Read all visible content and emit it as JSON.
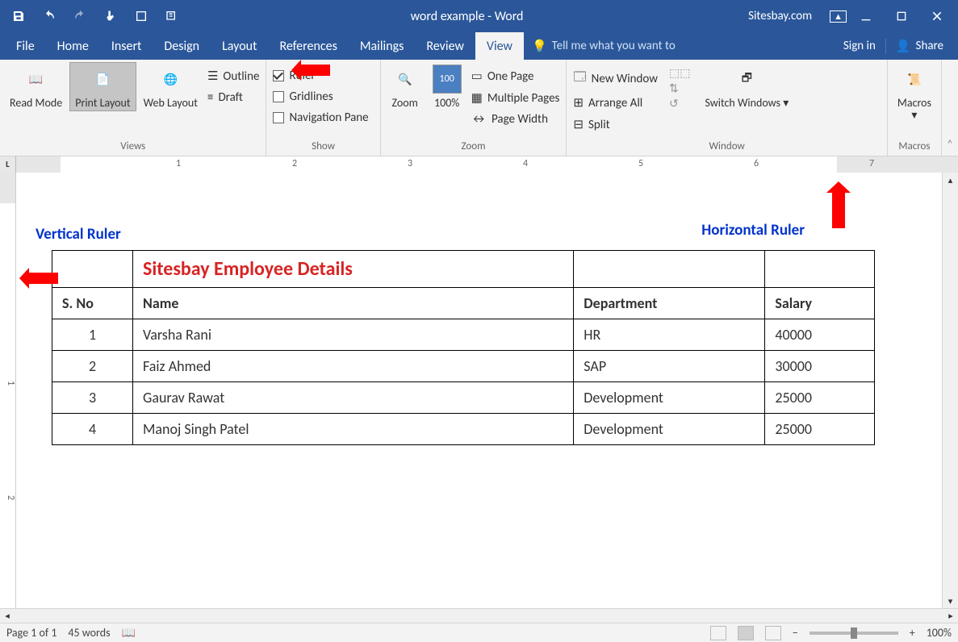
{
  "titlebar": {
    "title": "word example - Word",
    "site": "Sitesbay.com"
  },
  "tabs": {
    "file": "File",
    "home": "Home",
    "insert": "Insert",
    "design": "Design",
    "layout": "Layout",
    "references": "References",
    "mailings": "Mailings",
    "review": "Review",
    "view": "View",
    "tell": "Tell me what you want to",
    "signin": "Sign in",
    "share": "Share"
  },
  "ribbon": {
    "views": {
      "read": "Read Mode",
      "print": "Print Layout",
      "web": "Web Layout",
      "label": "Views"
    },
    "show": {
      "ruler": "Ruler",
      "gridlines": "Gridlines",
      "navpane": "Navigation Pane",
      "outline": "Outline",
      "draft": "Draft",
      "label": "Show"
    },
    "zoom": {
      "zoom": "Zoom",
      "hundred": "100%",
      "onepage": "One Page",
      "multi": "Multiple Pages",
      "width": "Page Width",
      "label": "Zoom"
    },
    "window": {
      "newwin": "New Window",
      "arrange": "Arrange All",
      "split": "Split",
      "switch": "Switch Windows",
      "label": "Window"
    },
    "macros": {
      "macros": "Macros",
      "label": "Macros"
    }
  },
  "annotations": {
    "vruler": "Vertical Ruler",
    "hruler": "Horizontal Ruler"
  },
  "table": {
    "title": "Sitesbay Employee Details",
    "headers": {
      "sno": "S. No",
      "name": "Name",
      "dept": "Department",
      "salary": "Salary"
    },
    "rows": [
      {
        "sno": "1",
        "name": "Varsha Rani",
        "dept": "HR",
        "salary": "40000"
      },
      {
        "sno": "2",
        "name": "Faiz Ahmed",
        "dept": "SAP",
        "salary": "30000"
      },
      {
        "sno": "3",
        "name": "Gaurav Rawat",
        "dept": "Development",
        "salary": "25000"
      },
      {
        "sno": "4",
        "name": "Manoj Singh Patel",
        "dept": "Development",
        "salary": "25000"
      }
    ]
  },
  "status": {
    "page": "Page 1 of 1",
    "words": "45 words",
    "zoom": "100%"
  },
  "ruler": {
    "n1": "1",
    "n2": "2",
    "n3": "3",
    "n4": "4",
    "n5": "5",
    "n6": "6",
    "n7": "7",
    "v1": "1",
    "v2": "2"
  },
  "sym": {
    "minus": "−",
    "plus": "+",
    "L": "L"
  }
}
